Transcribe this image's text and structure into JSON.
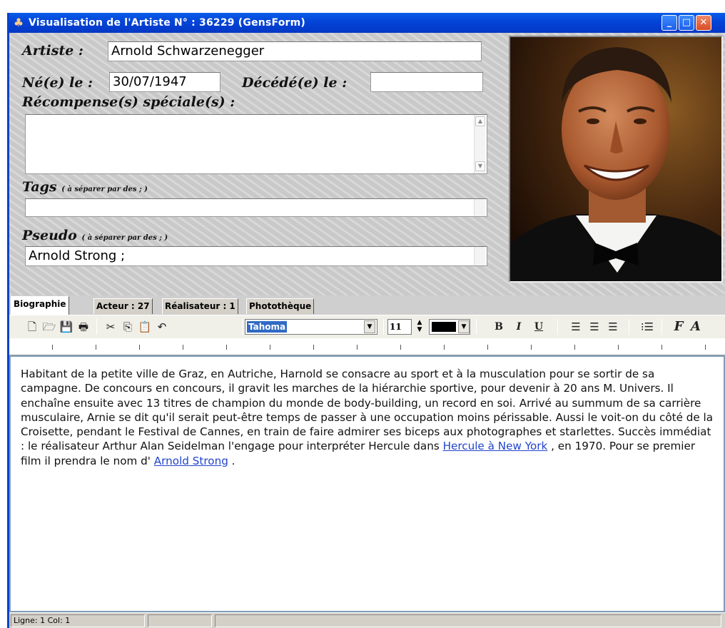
{
  "window": {
    "title": "Visualisation de l'Artiste N° : 36229 (GensForm)",
    "controls": {
      "minimize": "_",
      "maximize": "□",
      "close": "✕"
    }
  },
  "form": {
    "artiste_label": "Artiste :",
    "artiste_value": "Arnold Schwarzenegger",
    "ne_label": "Né(e) le :",
    "ne_value": "30/07/1947",
    "decede_label": "Décédé(e) le :",
    "decede_value": "",
    "recompense_label": "Récompense(s) spéciale(s) :",
    "recompense_value": "",
    "tags_label": "Tags",
    "tags_hint": "( à séparer par des ; )",
    "tags_value": "",
    "pseudo_label": "Pseudo",
    "pseudo_hint": "( à séparer par des ; )",
    "pseudo_value": "Arnold Strong ;"
  },
  "tabs": [
    {
      "label": "Biographie",
      "active": true
    },
    {
      "label": "Acteur : 27",
      "active": false
    },
    {
      "label": "Réalisateur : 1",
      "active": false
    },
    {
      "label": "Photothèque",
      "active": false
    }
  ],
  "toolbar": {
    "font": "Tahoma",
    "size": "11",
    "text_color": "#000000",
    "bold": "B",
    "italic": "I",
    "underline": "U",
    "font_btn": "F",
    "font_btn2": "A"
  },
  "icons": [
    "new-icon",
    "open-icon",
    "save-icon",
    "print-icon",
    "cut-icon",
    "copy-icon",
    "paste-icon",
    "undo-icon",
    "align-left-icon",
    "align-center-icon",
    "align-right-icon",
    "bullets-icon"
  ],
  "document": {
    "text_main": "Habitant de la petite ville de Graz, en Autriche, Harnold se consacre au sport et à la musculation pour se sortir de sa campagne. De concours en concours, il gravit les marches de la hiérarchie sportive, pour devenir à 20 ans M. Univers. Il enchaîne ensuite avec 13 titres de champion du monde de body-building, un record en soi. Arrivé au summum de sa carrière musculaire, Arnie se dit qu'il serait peut-être temps de passer à une occupation moins périssable. Aussi le voit-on du côté de la Croisette, pendant le Festival de Cannes, en train de faire admirer ses biceps aux photographes et starlettes. Succès immédiat : le réalisateur Arthur Alan Seidelman l'engage pour interpréter Hercule dans ",
    "link1": "Hercule à New York",
    "text_mid": " , en 1970. Pour se premier film il prendra le nom d' ",
    "link2": "Arnold Strong",
    "text_end": " ."
  },
  "status": {
    "position": "Ligne:  1  Col:  1"
  }
}
